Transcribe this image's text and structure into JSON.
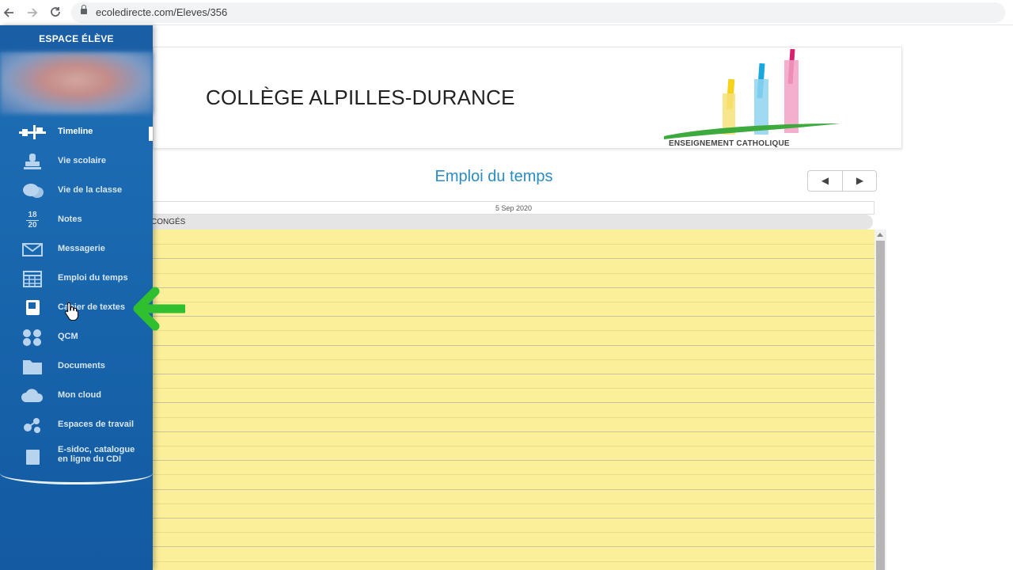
{
  "browser": {
    "url": "ecoledirecte.com/Eleves/356"
  },
  "sidebar": {
    "title": "ESPACE ÉLÈVE",
    "items": [
      {
        "label": "Timeline",
        "icon": "timeline-icon"
      },
      {
        "label": "Vie scolaire",
        "icon": "stamp-icon"
      },
      {
        "label": "Vie de la classe",
        "icon": "chat-bubbles-icon"
      },
      {
        "label": "Notes",
        "icon": "grade-fraction-icon",
        "icon_numerator": "18",
        "icon_denominator": "20"
      },
      {
        "label": "Messagerie",
        "icon": "envelope-icon"
      },
      {
        "label": "Emploi du temps",
        "icon": "calendar-icon"
      },
      {
        "label": "Cahier de textes",
        "icon": "notebook-icon"
      },
      {
        "label": "QCM",
        "icon": "qcm-icon"
      },
      {
        "label": "Documents",
        "icon": "folder-icon"
      },
      {
        "label": "Mon cloud",
        "icon": "cloud-icon"
      },
      {
        "label": "Espaces de travail",
        "icon": "workspace-icon"
      },
      {
        "label_line1": "E-sidoc, catalogue",
        "label_line2": "en ligne du CDI",
        "icon": "book-icon"
      }
    ],
    "active_item": "Timeline"
  },
  "banner": {
    "school_name": "COLLÈGE ALPILLES-DURANCE",
    "logo_caption": "ENSEIGNEMENT CATHOLIQUE"
  },
  "schedule": {
    "title": "Emploi du temps",
    "date": "5 Sep 2020",
    "all_day_label": "CONGÉS",
    "prev_glyph": "◀",
    "next_glyph": "▶"
  },
  "colors": {
    "sidebar_blue": "#1865ac",
    "title_blue": "#2a8cc2",
    "grid_yellow": "#fcef9a",
    "annotation_green": "#2fbf2f"
  }
}
